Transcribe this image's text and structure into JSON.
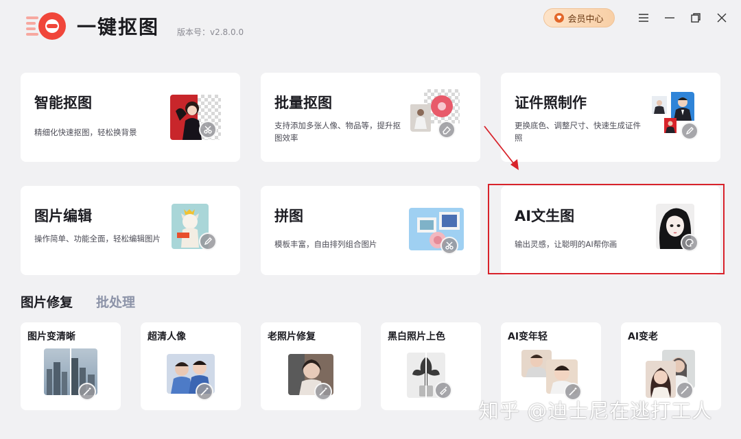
{
  "header": {
    "app_title": "一键抠图",
    "version": "版本号：v2.8.0.0",
    "vip_label": "会员中心",
    "icons": {
      "logo": "logo-mark",
      "vip": "vip-diamond-icon",
      "menu": "menu-icon",
      "minimize": "minimize-icon",
      "maximize": "maximize-icon",
      "close": "close-icon"
    },
    "colors": {
      "logo_red": "#f0463a",
      "vip_text": "#6b3a14"
    }
  },
  "features": [
    {
      "title": "智能抠图",
      "desc": "精细化快速抠图，轻松换背景",
      "badge_icon": "scissors-icon"
    },
    {
      "title": "批量抠图",
      "desc": "支持添加多张人像、物品等，提升抠图效率",
      "badge_icon": "eraser-icon"
    },
    {
      "title": "证件照制作",
      "desc": "更换底色、调整尺寸、快速生成证件照",
      "badge_icon": "pencil-icon"
    },
    {
      "title": "图片编辑",
      "desc": "操作简单、功能全面，轻松编辑图片",
      "badge_icon": "pencil-icon"
    },
    {
      "title": "拼图",
      "desc": "模板丰富，自由排列组合图片",
      "badge_icon": "scissors-icon"
    },
    {
      "title": "AI文生图",
      "desc": "输出灵感，让聪明的AI帮你画",
      "badge_icon": "palette-icon",
      "highlighted": true
    }
  ],
  "annotation": {
    "arrow_color": "#d8222a",
    "box_color": "#d8222a"
  },
  "tabs": [
    {
      "label": "图片修复",
      "active": true
    },
    {
      "label": "批处理",
      "active": false
    }
  ],
  "tools": [
    {
      "title": "图片变清晰",
      "badge_icon": "wand-icon"
    },
    {
      "title": "超清人像",
      "badge_icon": "wand-icon"
    },
    {
      "title": "老照片修复",
      "badge_icon": "wand-icon"
    },
    {
      "title": "黑白照片上色",
      "badge_icon": "brush-icon"
    },
    {
      "title": "AI变年轻",
      "badge_icon": "wand-icon"
    },
    {
      "title": "AI变老",
      "badge_icon": "wand-icon"
    }
  ],
  "watermark": "知乎 @迪士尼在逃打工人"
}
